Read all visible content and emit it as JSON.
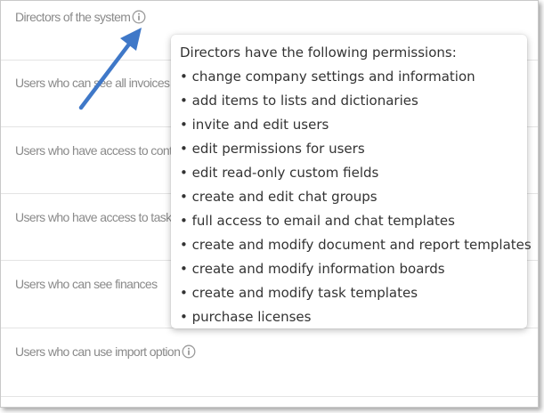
{
  "rows": [
    {
      "label": "Directors of the system",
      "has_info": true
    },
    {
      "label": "Users who can see all invoices",
      "has_info": false
    },
    {
      "label": "Users who have access to contracts",
      "has_info": false
    },
    {
      "label": "Users who have access to tasks",
      "has_info": false
    },
    {
      "label": "Users who can see finances",
      "has_info": false
    },
    {
      "label": "Users who can use import option",
      "has_info": true
    }
  ],
  "tooltip": {
    "title": "Directors have the following permissions:",
    "bullet": "•",
    "items": [
      "change company settings and information",
      "add items to lists and dictionaries",
      "invite and edit users",
      "edit permissions for users",
      "edit read-only custom fields",
      "create and edit chat groups",
      "full access to email and chat templates",
      "create and modify document and report templates",
      "create and modify information boards",
      "create and modify task templates",
      "purchase licenses"
    ]
  },
  "colors": {
    "arrow": "#3f78c8",
    "label_text": "#8a8a8a",
    "tooltip_text": "#333333",
    "info_icon": "#9b9b9b"
  },
  "icons": {
    "info": "info-circle-icon",
    "arrow": "annotation-arrow"
  }
}
